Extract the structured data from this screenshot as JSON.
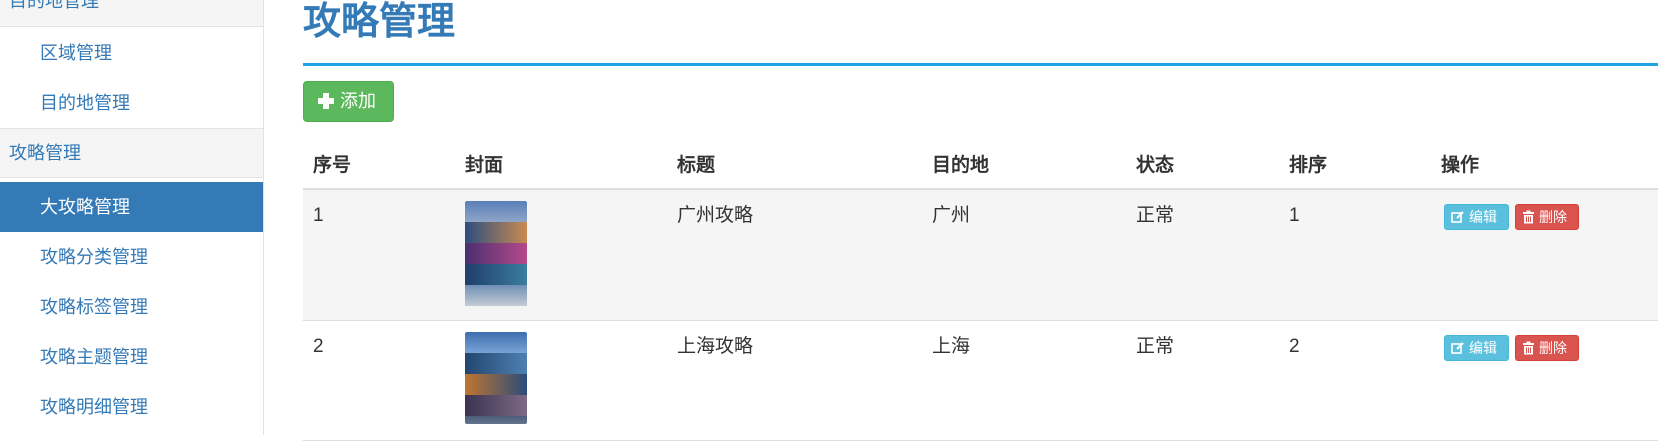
{
  "sidebar": {
    "groups": [
      {
        "label": "目的地管理"
      },
      {
        "label": "攻略管理"
      }
    ],
    "items": [
      {
        "label": "区域管理"
      },
      {
        "label": "目的地管理"
      },
      {
        "label": "大攻略管理"
      },
      {
        "label": "攻略分类管理"
      },
      {
        "label": "攻略标签管理"
      },
      {
        "label": "攻略主题管理"
      },
      {
        "label": "攻略明细管理"
      }
    ]
  },
  "main": {
    "title": "攻略管理",
    "add_label": "添加",
    "columns": [
      "序号",
      "封面",
      "标题",
      "目的地",
      "状态",
      "排序",
      "操作"
    ],
    "rows": [
      {
        "index": "1",
        "title": "广州攻略",
        "destination": "广州",
        "status": "正常",
        "order": "1"
      },
      {
        "index": "2",
        "title": "上海攻略",
        "destination": "上海",
        "status": "正常",
        "order": "2"
      }
    ],
    "edit_label": "编辑",
    "delete_label": "删除"
  },
  "icons": {
    "add": "plus-icon",
    "edit": "edit-icon",
    "delete": "trash-icon"
  },
  "colors": {
    "primary": "#337ab7",
    "success": "#5cb85c",
    "info": "#5bc0de",
    "danger": "#d9534f",
    "title_rule": "#22a2e2"
  }
}
